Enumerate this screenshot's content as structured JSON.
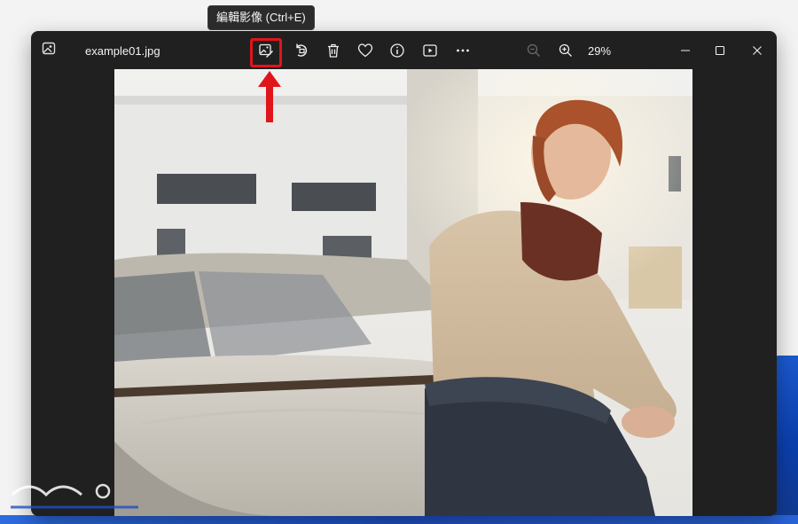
{
  "window": {
    "filename": "example01.jpg",
    "zoom_level": "29%"
  },
  "toolbar": {
    "edit_tooltip": "編輯影像 (Ctrl+E)",
    "icons": [
      "edit-image-icon",
      "rotate-icon",
      "delete-icon",
      "favorite-icon",
      "info-icon",
      "slideshow-icon",
      "more-icon",
      "zoom-out-icon",
      "zoom-in-icon"
    ]
  },
  "colors": {
    "window_bg": "#202020",
    "highlight": "#e0151b",
    "text": "#f2f2f2"
  }
}
